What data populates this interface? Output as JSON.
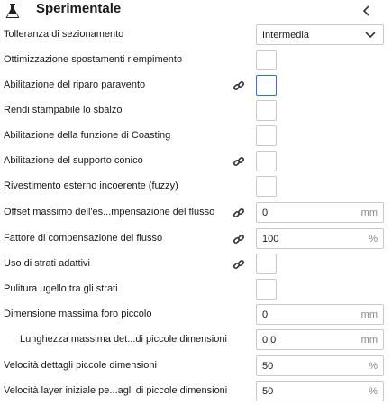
{
  "header": {
    "title": "Sperimentale",
    "icon": "flask-icon",
    "collapse_icon": "chevron-left-icon"
  },
  "settings": [
    {
      "label": "Tolleranza di sezionamento",
      "type": "select",
      "value": "Intermedia"
    },
    {
      "label": "Ottimizzazione spostamenti riempimento",
      "type": "checkbox",
      "checked": false
    },
    {
      "label": "Abilitazione del riparo paravento",
      "type": "checkbox",
      "checked": false,
      "linked": true,
      "focused": true
    },
    {
      "label": "Rendi stampabile lo sbalzo",
      "type": "checkbox",
      "checked": false
    },
    {
      "label": "Abilitazione della funzione di Coasting",
      "type": "checkbox",
      "checked": false
    },
    {
      "label": "Abilitazione del supporto conico",
      "type": "checkbox",
      "checked": false,
      "linked": true
    },
    {
      "label": "Rivestimento esterno incoerente (fuzzy)",
      "type": "checkbox",
      "checked": false
    },
    {
      "label": "Offset massimo dell'es...mpensazione del flusso",
      "type": "number",
      "value": "0",
      "unit": "mm",
      "linked": true
    },
    {
      "label": "Fattore di compensazione del flusso",
      "type": "number",
      "value": "100",
      "unit": "%",
      "linked": true
    },
    {
      "label": "Uso di strati adattivi",
      "type": "checkbox",
      "checked": false,
      "linked": true
    },
    {
      "label": "Pulitura ugello tra gli strati",
      "type": "checkbox",
      "checked": false
    },
    {
      "label": "Dimensione massima foro piccolo",
      "type": "number",
      "value": "0",
      "unit": "mm"
    },
    {
      "label": "Lunghezza massima det...di piccole dimensioni",
      "type": "number",
      "value": "0.0",
      "unit": "mm",
      "indent": true
    },
    {
      "label": "Velocità dettagli piccole dimensioni",
      "type": "number",
      "value": "50",
      "unit": "%"
    },
    {
      "label": "Velocità layer iniziale pe...agli di piccole dimensioni",
      "type": "number",
      "value": "50",
      "unit": "%"
    }
  ]
}
